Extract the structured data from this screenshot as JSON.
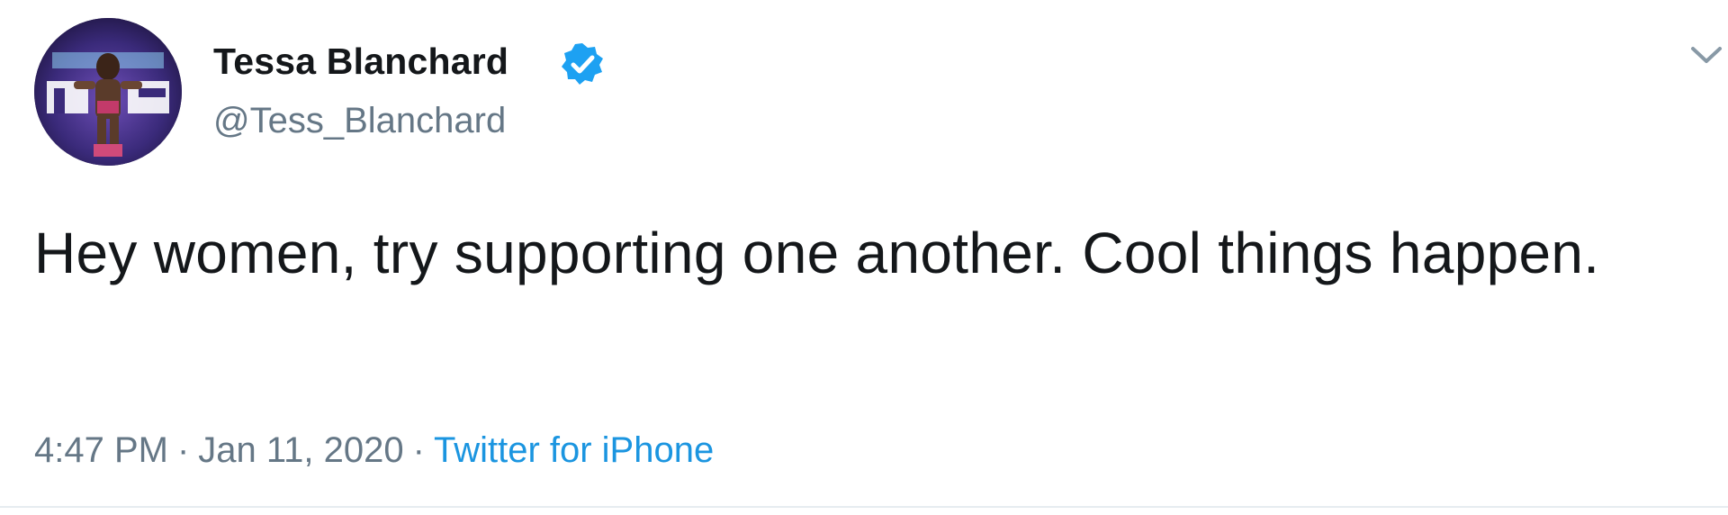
{
  "tweet": {
    "author": {
      "display_name": "Tessa Blanchard",
      "handle": "@Tess_Blanchard",
      "verified_icon": "verified-badge-icon",
      "avatar": "profile-avatar"
    },
    "text": "Hey women, try supporting one another. Cool things happen.",
    "time": "4:47 PM",
    "separator": "·",
    "date": "Jan 11, 2020",
    "source": "Twitter for iPhone",
    "menu_icon": "chevron-down-icon"
  },
  "colors": {
    "primary_text": "#14171a",
    "secondary_text": "#657786",
    "link": "#1b95e0",
    "verified_badge": "#1da1f2",
    "background": "#ffffff"
  }
}
